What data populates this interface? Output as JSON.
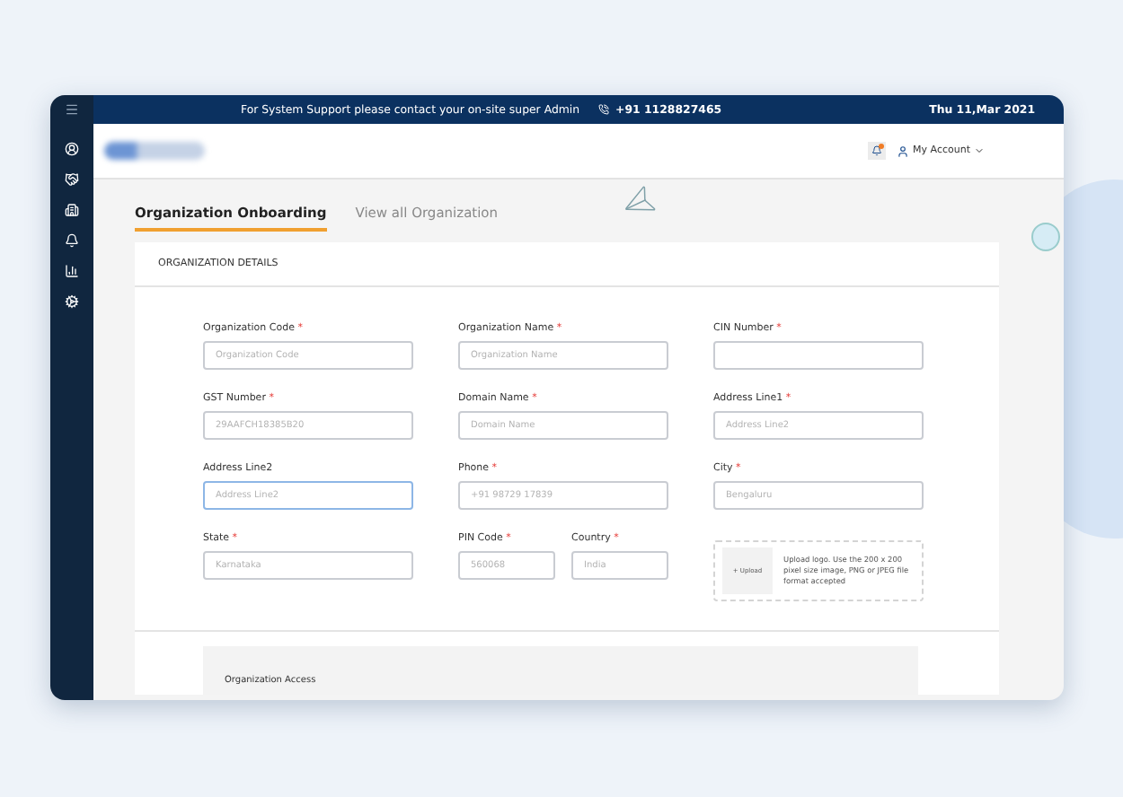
{
  "topbar": {
    "support_text": "For System Support please contact your on-site super Admin",
    "phone": "+91 1128827465",
    "date": "Thu 11,Mar 2021"
  },
  "header": {
    "notification_dot": true,
    "account": "My Account"
  },
  "tabs": [
    {
      "label": "Organization Onboarding",
      "selected": true
    },
    {
      "label": "View all Organization",
      "selected": false
    }
  ],
  "section": {
    "title": "ORGANIZATION DETAILS"
  },
  "fields": [
    {
      "kind": "full",
      "label": "Organization Code",
      "required_mark": "*",
      "placeholder": "Organization Code",
      "focused": false
    },
    {
      "kind": "full",
      "label": "Organization Name",
      "required_mark": "*",
      "placeholder": "Organization Name",
      "focused": false
    },
    {
      "kind": "full",
      "label": "CIN Number",
      "required_mark": "*",
      "focused": false
    },
    {
      "kind": "full",
      "label": "GST Number",
      "required_mark": "*",
      "placeholder": "29AAFCH18385B20",
      "focused": false
    },
    {
      "kind": "full",
      "label": "Domain Name",
      "required_mark": "*",
      "placeholder": "Domain Name",
      "focused": false
    },
    {
      "kind": "full",
      "label": "Address Line1",
      "required_mark": "*",
      "placeholder": "Address Line2",
      "focused": false
    },
    {
      "kind": "full",
      "label": "Address Line2",
      "placeholder": "Address Line2",
      "focused": true
    },
    {
      "kind": "full",
      "label": "Phone",
      "required_mark": "*",
      "placeholder": "+91 98729 17839",
      "focused": false
    },
    {
      "kind": "full",
      "label": "City",
      "required_mark": "*",
      "placeholder": "Bengaluru",
      "focused": false
    },
    {
      "kind": "full",
      "label": "State",
      "required_mark": "*",
      "placeholder": "Karnataka",
      "focused": false
    },
    {
      "kind": "half",
      "label": "PIN Code",
      "required_mark": "*",
      "placeholder": "560068",
      "focused": false
    },
    {
      "kind": "half",
      "label": "Country",
      "required_mark": "*",
      "placeholder": "India",
      "focused": false
    },
    {
      "kind": "upload",
      "button": "+ Upload",
      "hint": "Upload logo. Use the 200 x 200 pixel size image, PNG or JPEG file format accepted"
    }
  ],
  "access_section": {
    "title": "Organization Access"
  }
}
